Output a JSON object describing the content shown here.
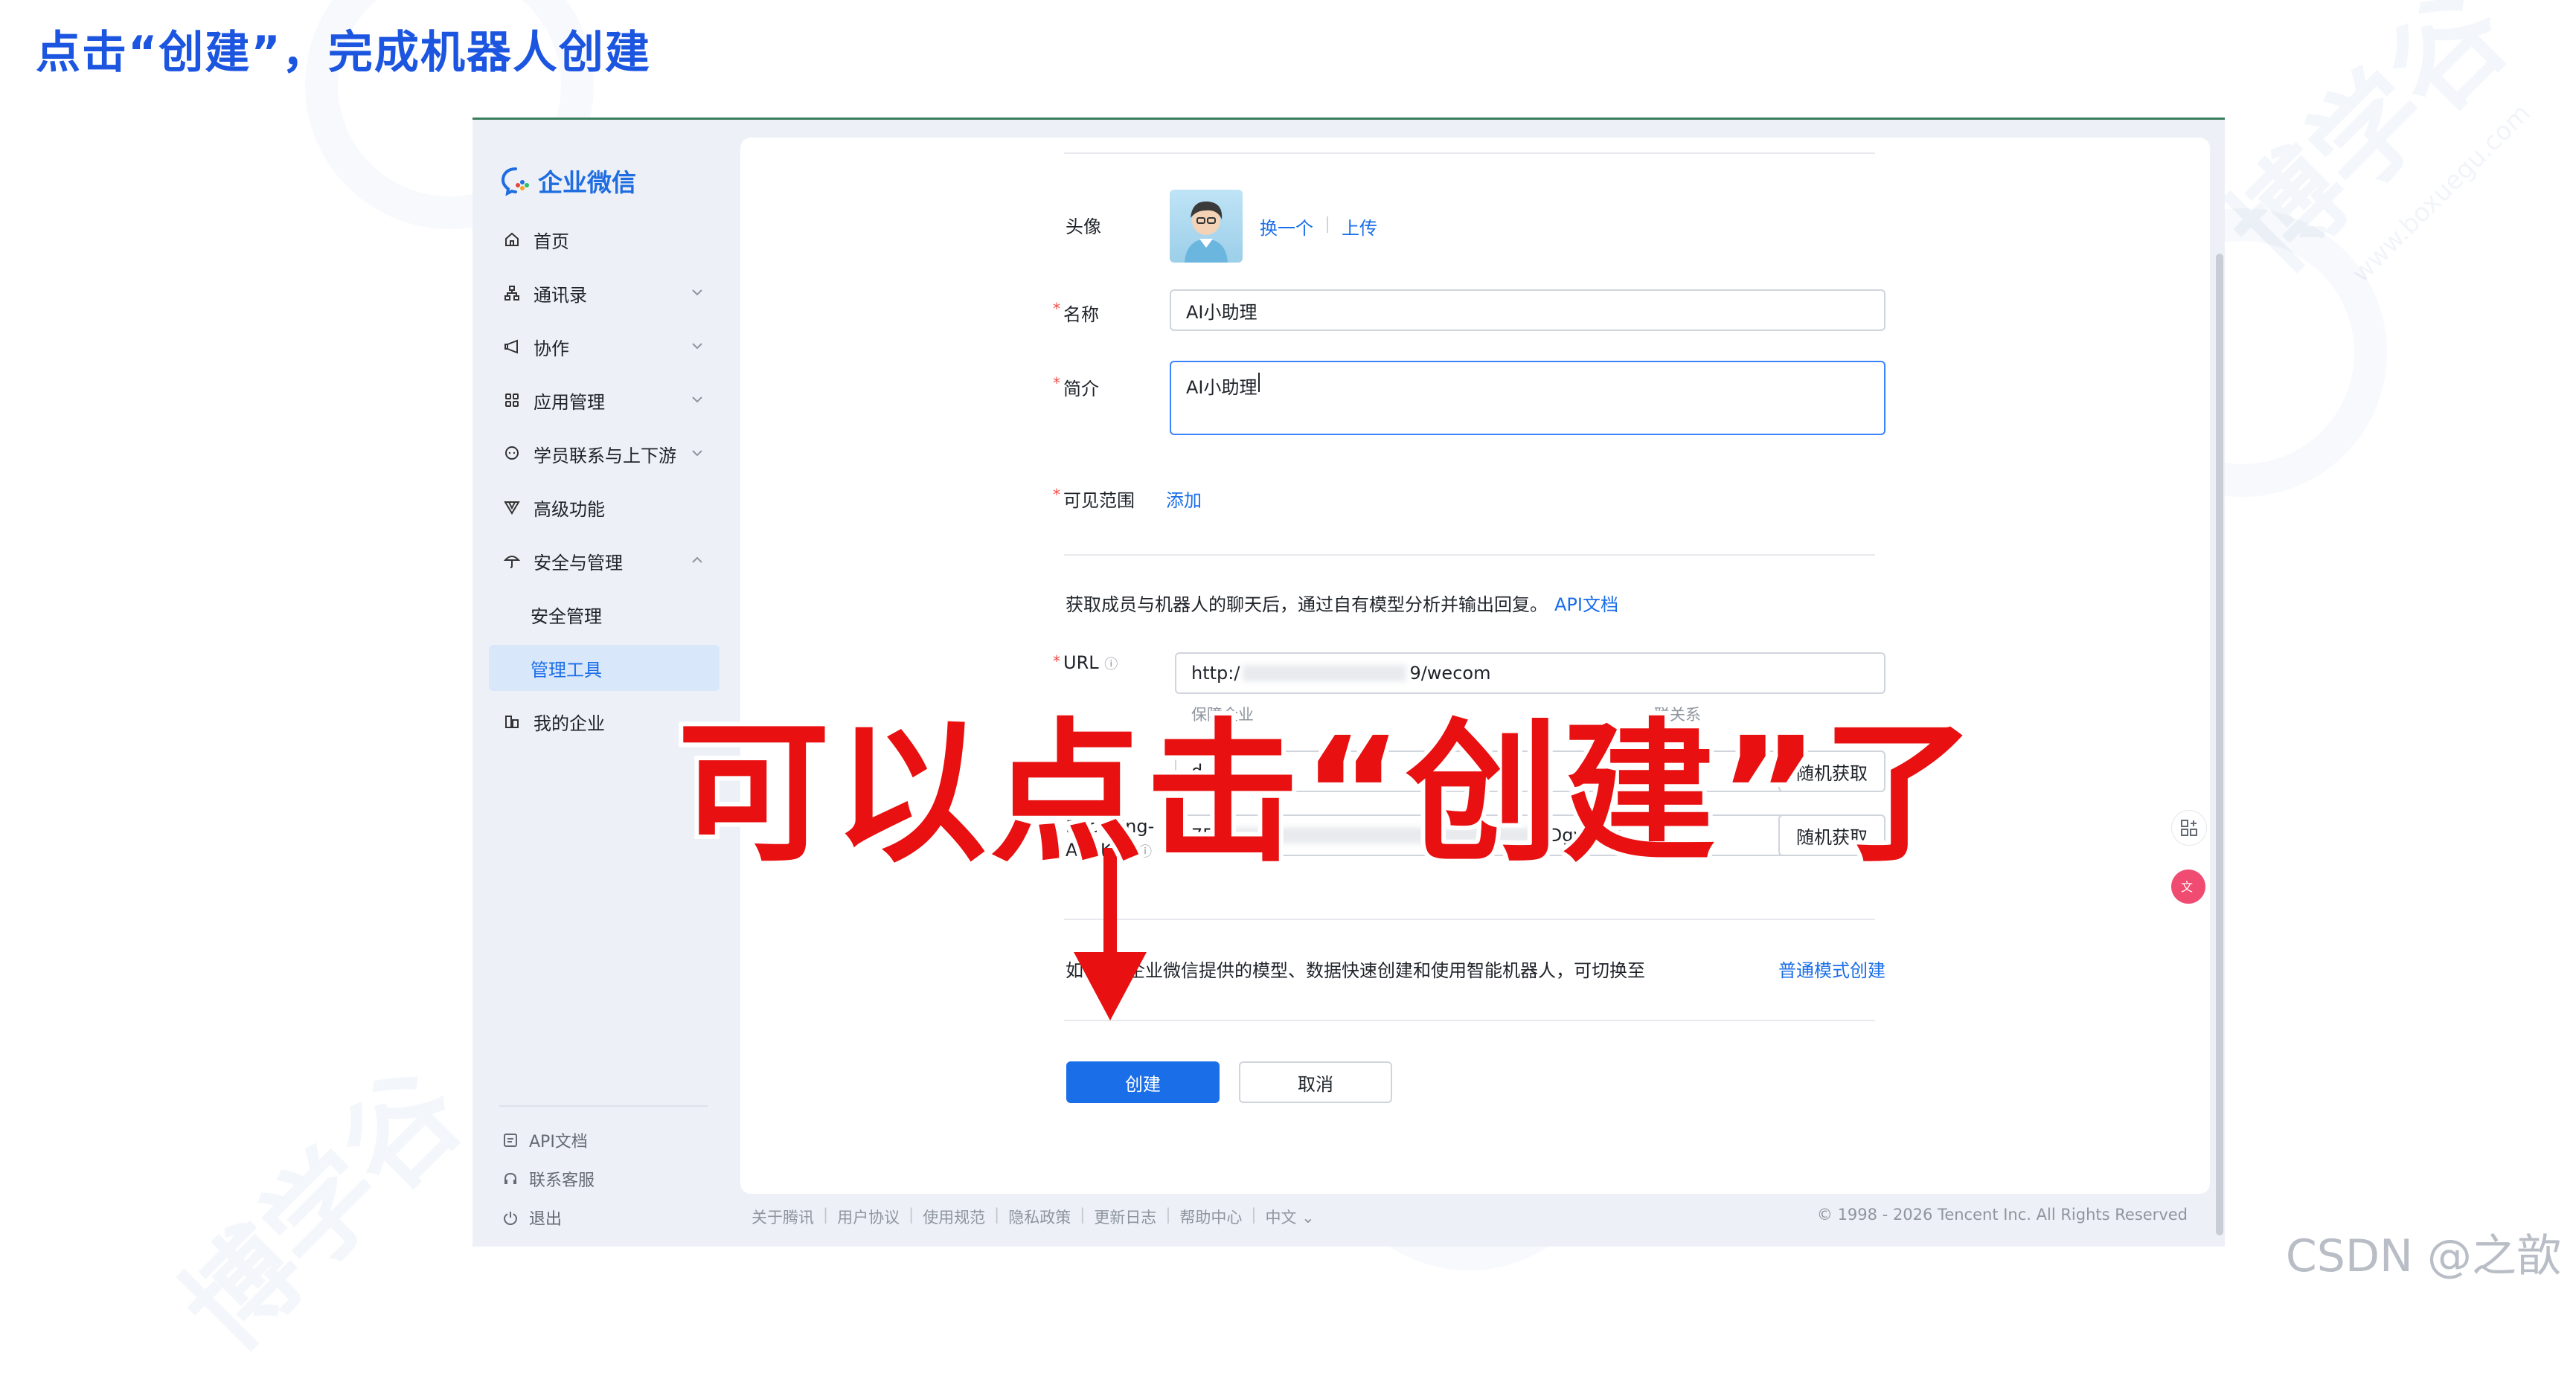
{
  "slide_title": "点击“创建”，完成机器人创建",
  "overlay_annotation": "可以点击“创建”了",
  "csdn_mark": "CSDN @之歆",
  "watermark": {
    "text": "博学谷",
    "url": "www.boxuegu.com"
  },
  "app": {
    "logo_text": "企业微信"
  },
  "sidebar": {
    "items": [
      {
        "label": "首页",
        "icon": "home-icon"
      },
      {
        "label": "通讯录",
        "icon": "org-chart-icon",
        "expand": "chevron-down-icon"
      },
      {
        "label": "协作",
        "icon": "collab-icon",
        "expand": "chevron-down-icon"
      },
      {
        "label": "应用管理",
        "icon": "grid-icon",
        "expand": "chevron-down-icon"
      },
      {
        "label": "学员联系与上下游",
        "icon": "chat-icon",
        "expand": "chevron-down-icon"
      },
      {
        "label": "高级功能",
        "icon": "advanced-icon"
      },
      {
        "label": "安全与管理",
        "icon": "umbrella-icon",
        "expand": "chevron-up-icon"
      },
      {
        "label": "安全管理",
        "sub": true
      },
      {
        "label": "管理工具",
        "sub": true,
        "active": true
      },
      {
        "label": "我的企业",
        "icon": "company-icon"
      }
    ],
    "footer": [
      {
        "label": "API文档",
        "icon": "doc-icon"
      },
      {
        "label": "联系客服",
        "icon": "headset-icon"
      },
      {
        "label": "退出",
        "icon": "power-icon"
      }
    ]
  },
  "form": {
    "avatar_label": "头像",
    "avatar_change": "换一个",
    "avatar_upload": "上传",
    "name_label": "名称",
    "name_value": "AI小助理",
    "intro_label": "简介",
    "intro_value": "AI小助理",
    "scope_label": "可见范围",
    "scope_add": "添加",
    "api_desc": "获取成员与机器人的聊天后，通过自有模型分析并输出回复。",
    "api_doc_link": "API文档",
    "url_label": "URL",
    "url_prefix": "http:/",
    "url_suffix": "9/wecom",
    "url_hint_left": "保障企业",
    "url_hint_right": "联关系",
    "token_prefix": "d",
    "encoding_label_1": "Encoding-",
    "encoding_label_2": "AESKey",
    "encoding_prefix": "7F",
    "encoding_suffix": "TDgyxlu2",
    "random_btn": "随机获取",
    "mode_text_left": "如",
    "mode_text": "企业微信提供的模型、数据快速创建和使用智能机器人，可切换至",
    "mode_link": "普通模式创建",
    "create_btn": "创建",
    "cancel_btn": "取消"
  },
  "footer": {
    "links": [
      "关于腾讯",
      "用户协议",
      "使用规范",
      "隐私政策",
      "更新日志",
      "帮助中心",
      "中文"
    ],
    "copyright": "© 1998 - 2026 Tencent Inc. All Rights Reserved"
  },
  "colors": {
    "brand": "#1a6ee8",
    "annotation": "#e81010",
    "title": "#1b55e0",
    "required": "#f54a45"
  }
}
